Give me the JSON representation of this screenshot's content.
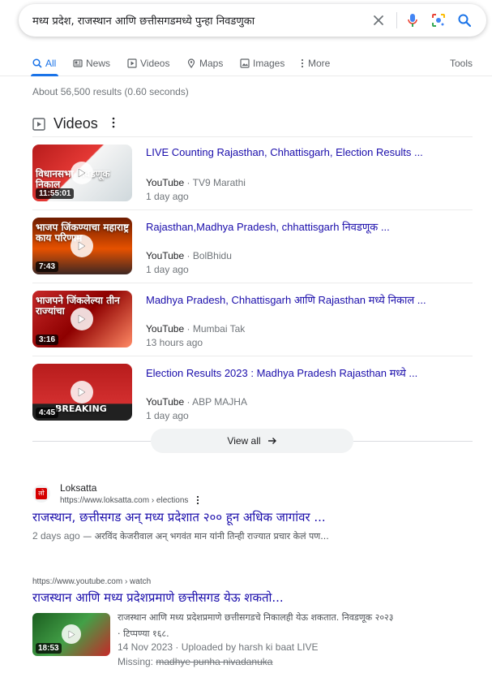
{
  "search": {
    "query": "मध्य प्रदेश, राजस्थान आणि छत्तीसगडमध्ये पुन्हा निवडणुका"
  },
  "tabs": [
    {
      "label": "All",
      "active": true,
      "icon": "search-icon"
    },
    {
      "label": "News",
      "icon": "news-icon"
    },
    {
      "label": "Videos",
      "icon": "video-icon"
    },
    {
      "label": "Maps",
      "icon": "map-pin-icon"
    },
    {
      "label": "Images",
      "icon": "image-icon"
    },
    {
      "label": "More",
      "icon": "dots-vertical-icon"
    }
  ],
  "tools_label": "Tools",
  "result_stats": "About 56,500 results (0.60 seconds)",
  "videos": {
    "section_title": "Videos",
    "items": [
      {
        "title": "LIVE Counting Rajasthan, Chhattisgarh, Election Results ...",
        "source": "YouTube",
        "channel": "TV9 Marathi",
        "time": "1 day ago",
        "duration": "11:55:01",
        "thumb_text": "विधानसभा निवडणूक निकाल"
      },
      {
        "title": "Rajasthan,Madhya Pradesh, chhattisgarh निवडणूक ...",
        "source": "YouTube",
        "channel": "BolBhidu",
        "time": "1 day ago",
        "duration": "7:43",
        "thumb_text": "भाजप जिंकण्याचा महाराष्ट्र काय परिणाम"
      },
      {
        "title": "Madhya Pradesh, Chhattisgarh आणि Rajasthan मध्ये निकाल ...",
        "source": "YouTube",
        "channel": "Mumbai Tak",
        "time": "13 hours ago",
        "duration": "3:16",
        "thumb_text": "भाजपने जिंकलेल्या तीन राज्यांचा"
      },
      {
        "title": "Election Results 2023 : Madhya Pradesh Rajasthan मध्ये ...",
        "source": "YouTube",
        "channel": "ABP MAJHA",
        "time": "1 day ago",
        "duration": "4:45",
        "thumb_text": "BREAKING"
      }
    ],
    "view_all": "View all"
  },
  "result1": {
    "site_name": "Loksatta",
    "url": "https://www.loksatta.com › elections",
    "favicon_text": "लो",
    "title": "राजस्थान, छत्तीसगड अन् मध्य प्रदेशात २०० हून अधिक जागांवर ...",
    "date": "2 days ago",
    "snippet": " — अरविंद केजरीवाल अन् भगवंत मान यांनी तिन्ही राज्यात प्रचार केलं पण..."
  },
  "result2": {
    "url": "https://www.youtube.com › watch",
    "title": "राजस्थान आणि मध्य प्रदेशप्रमाणे छत्तीसगड येऊ शकतो...",
    "snippet_line1": "राजस्थान आणि मध्य प्रदेशप्रमाणे छत्तीसगडचे निकालही येऊ शकतात. निवडणूक २०२३",
    "snippet_line2": "· टिप्पण्या १६८.",
    "meta": "14 Nov 2023 · Uploaded by harsh ki baat LIVE",
    "missing_label": "Missing: ",
    "missing_terms": "madhye punha nivadanuka",
    "duration": "18:53"
  },
  "colors": {
    "link": "#1a0dab",
    "accent": "#1a73e8",
    "text_secondary": "#70757a"
  }
}
